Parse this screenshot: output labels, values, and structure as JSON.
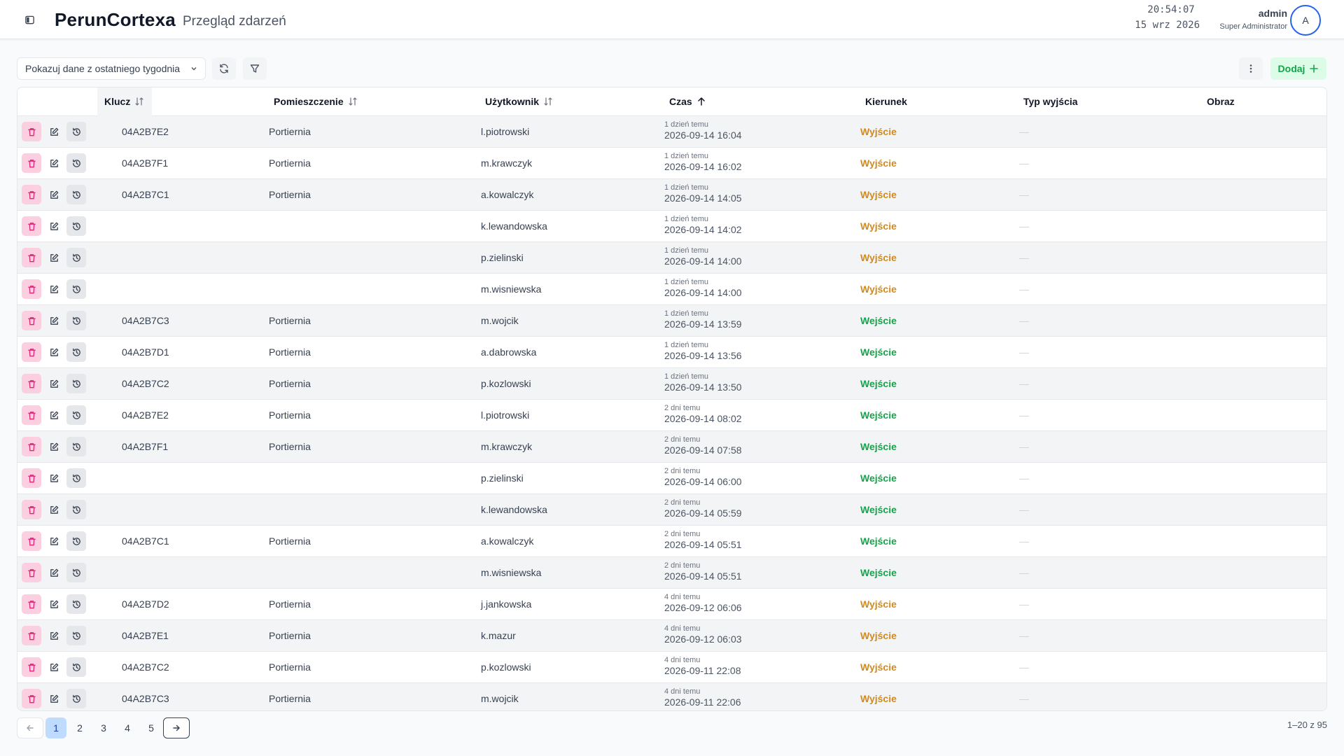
{
  "header": {
    "app_title": "PerunCortexa",
    "page_subtitle": "Przegląd zdarzeń",
    "clock_time": "20:54:07",
    "clock_date": "15 wrz 2026",
    "user_name": "admin",
    "user_role": "Super Administrator",
    "avatar_letter": "A"
  },
  "toolbar": {
    "range_select": "Pokazuj dane z ostatniego tygodnia",
    "add_label": "Dodaj"
  },
  "columns": {
    "key": "Klucz",
    "room": "Pomieszczenie",
    "user": "Użytkownik",
    "time": "Czas",
    "direction": "Kierunek",
    "exit_type": "Typ wyjścia",
    "image": "Obraz"
  },
  "rows": [
    {
      "key": "04A2B7E2",
      "room": "Portiernia",
      "user": "l.piotrowski",
      "rel": "1 dzień temu",
      "time": "2026-09-14 16:04",
      "dir": "Wyjście",
      "dir_type": "out",
      "exit": "—"
    },
    {
      "key": "04A2B7F1",
      "room": "Portiernia",
      "user": "m.krawczyk",
      "rel": "1 dzień temu",
      "time": "2026-09-14 16:02",
      "dir": "Wyjście",
      "dir_type": "out",
      "exit": "—"
    },
    {
      "key": "04A2B7C1",
      "room": "Portiernia",
      "user": "a.kowalczyk",
      "rel": "1 dzień temu",
      "time": "2026-09-14 14:05",
      "dir": "Wyjście",
      "dir_type": "out",
      "exit": "—"
    },
    {
      "key": "",
      "room": "",
      "user": "k.lewandowska",
      "rel": "1 dzień temu",
      "time": "2026-09-14 14:02",
      "dir": "Wyjście",
      "dir_type": "out",
      "exit": "—"
    },
    {
      "key": "",
      "room": "",
      "user": "p.zielinski",
      "rel": "1 dzień temu",
      "time": "2026-09-14 14:00",
      "dir": "Wyjście",
      "dir_type": "out",
      "exit": "—"
    },
    {
      "key": "",
      "room": "",
      "user": "m.wisniewska",
      "rel": "1 dzień temu",
      "time": "2026-09-14 14:00",
      "dir": "Wyjście",
      "dir_type": "out",
      "exit": "—"
    },
    {
      "key": "04A2B7C3",
      "room": "Portiernia",
      "user": "m.wojcik",
      "rel": "1 dzień temu",
      "time": "2026-09-14 13:59",
      "dir": "Wejście",
      "dir_type": "in",
      "exit": "—"
    },
    {
      "key": "04A2B7D1",
      "room": "Portiernia",
      "user": "a.dabrowska",
      "rel": "1 dzień temu",
      "time": "2026-09-14 13:56",
      "dir": "Wejście",
      "dir_type": "in",
      "exit": "—"
    },
    {
      "key": "04A2B7C2",
      "room": "Portiernia",
      "user": "p.kozlowski",
      "rel": "1 dzień temu",
      "time": "2026-09-14 13:50",
      "dir": "Wejście",
      "dir_type": "in",
      "exit": "—"
    },
    {
      "key": "04A2B7E2",
      "room": "Portiernia",
      "user": "l.piotrowski",
      "rel": "2 dni temu",
      "time": "2026-09-14 08:02",
      "dir": "Wejście",
      "dir_type": "in",
      "exit": "—"
    },
    {
      "key": "04A2B7F1",
      "room": "Portiernia",
      "user": "m.krawczyk",
      "rel": "2 dni temu",
      "time": "2026-09-14 07:58",
      "dir": "Wejście",
      "dir_type": "in",
      "exit": "—"
    },
    {
      "key": "",
      "room": "",
      "user": "p.zielinski",
      "rel": "2 dni temu",
      "time": "2026-09-14 06:00",
      "dir": "Wejście",
      "dir_type": "in",
      "exit": "—"
    },
    {
      "key": "",
      "room": "",
      "user": "k.lewandowska",
      "rel": "2 dni temu",
      "time": "2026-09-14 05:59",
      "dir": "Wejście",
      "dir_type": "in",
      "exit": "—"
    },
    {
      "key": "04A2B7C1",
      "room": "Portiernia",
      "user": "a.kowalczyk",
      "rel": "2 dni temu",
      "time": "2026-09-14 05:51",
      "dir": "Wejście",
      "dir_type": "in",
      "exit": "—"
    },
    {
      "key": "",
      "room": "",
      "user": "m.wisniewska",
      "rel": "2 dni temu",
      "time": "2026-09-14 05:51",
      "dir": "Wejście",
      "dir_type": "in",
      "exit": "—"
    },
    {
      "key": "04A2B7D2",
      "room": "Portiernia",
      "user": "j.jankowska",
      "rel": "4 dni temu",
      "time": "2026-09-12 06:06",
      "dir": "Wyjście",
      "dir_type": "out",
      "exit": "—"
    },
    {
      "key": "04A2B7E1",
      "room": "Portiernia",
      "user": "k.mazur",
      "rel": "4 dni temu",
      "time": "2026-09-12 06:03",
      "dir": "Wyjście",
      "dir_type": "out",
      "exit": "—"
    },
    {
      "key": "04A2B7C2",
      "room": "Portiernia",
      "user": "p.kozlowski",
      "rel": "4 dni temu",
      "time": "2026-09-11 22:08",
      "dir": "Wyjście",
      "dir_type": "out",
      "exit": "—"
    },
    {
      "key": "04A2B7C3",
      "room": "Portiernia",
      "user": "m.wojcik",
      "rel": "4 dni temu",
      "time": "2026-09-11 22:06",
      "dir": "Wyjście",
      "dir_type": "out",
      "exit": "—"
    }
  ],
  "pagination": {
    "pages": [
      "1",
      "2",
      "3",
      "4",
      "5"
    ],
    "current": "1",
    "range_info": "1–20 z 95"
  },
  "icons": {
    "sidebar_toggle": "sidebar-toggle-icon",
    "refresh": "refresh-icon",
    "filter": "filter-icon",
    "more": "more-vertical-icon",
    "add": "plus-icon",
    "delete": "trash-icon",
    "edit": "edit-icon",
    "history": "history-icon"
  },
  "colors": {
    "out": "#d08a1f",
    "in": "#16a34a",
    "accent": "#2563eb",
    "delete_bg": "#fbcfe0"
  }
}
